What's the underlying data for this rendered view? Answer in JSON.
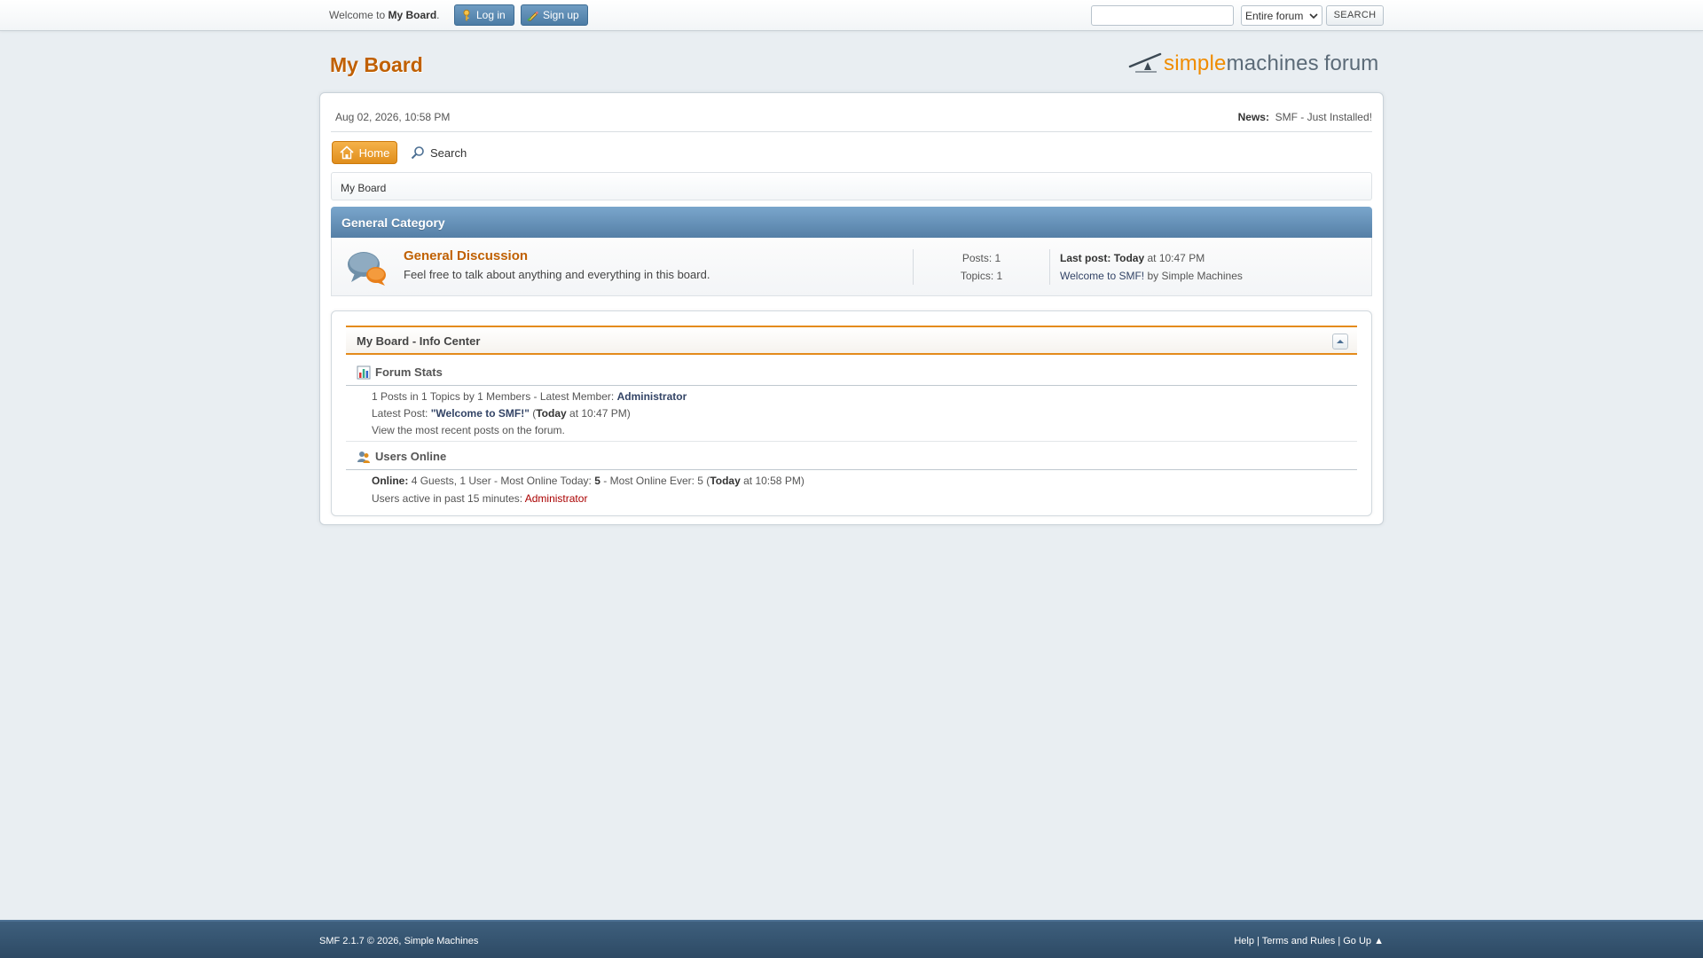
{
  "topbar": {
    "welcome_prefix": "Welcome to",
    "welcome_board": "My Board",
    "welcome_suffix": ".",
    "login_label": "Log in",
    "signup_label": "Sign up",
    "search_value": "",
    "search_scope": "Entire forum",
    "search_button": "SEARCH"
  },
  "header": {
    "forum_title": "My Board",
    "logo_simple": "simple",
    "logo_machines": "machines",
    "logo_forum": "forum"
  },
  "upper": {
    "date": "Aug 02, 2026, 10:58 PM",
    "news_label": "News:",
    "news_text": "SMF - Just Installed!"
  },
  "menu": {
    "home_label": "Home",
    "search_label": "Search"
  },
  "breadcrumb": {
    "item": "My Board"
  },
  "category": {
    "title": "General Category",
    "board": {
      "name": "General Discussion",
      "description": "Feel free to talk about anything and everything in this board.",
      "posts": "Posts: 1",
      "topics": "Topics: 1",
      "last_post_label": "Last post:",
      "last_post_day": "Today",
      "last_post_time": "at 10:47 PM",
      "last_post_topic": "Welcome to SMF!",
      "last_post_by": "by Simple Machines"
    }
  },
  "info_center": {
    "title": "My Board - Info Center",
    "stats_title": "Forum Stats",
    "stats_line1_prefix": "1 Posts in 1 Topics by 1 Members - Latest Member:",
    "stats_latest_member": "Administrator",
    "stats_line2_prefix": "Latest Post:",
    "stats_latest_post": "\"Welcome to SMF!\"",
    "stats_latest_post_open": "(",
    "stats_latest_post_day": "Today",
    "stats_latest_post_time": "at 10:47 PM)",
    "stats_line3": "View the most recent posts on the forum.",
    "online_title": "Users Online",
    "online_label": "Online:",
    "online_text": "4 Guests, 1 User  - Most Online Today:",
    "online_today_count": "5",
    "online_ever_text": "-  Most Online Ever: 5 (",
    "online_ever_day": "Today",
    "online_ever_time": "at 10:58 PM)",
    "active_text": "Users active in past 15 minutes:",
    "active_user": "Administrator"
  },
  "footer": {
    "left_text": "SMF 2.1.7 © 2026,",
    "left_link": "Simple Machines",
    "help": "Help",
    "terms": "Terms and Rules",
    "goup": "Go Up ▲",
    "sep": "|"
  },
  "colors": {
    "accent_orange": "#c06002",
    "header_blue": "#557fa6",
    "footer_blue": "#2d4a64"
  }
}
